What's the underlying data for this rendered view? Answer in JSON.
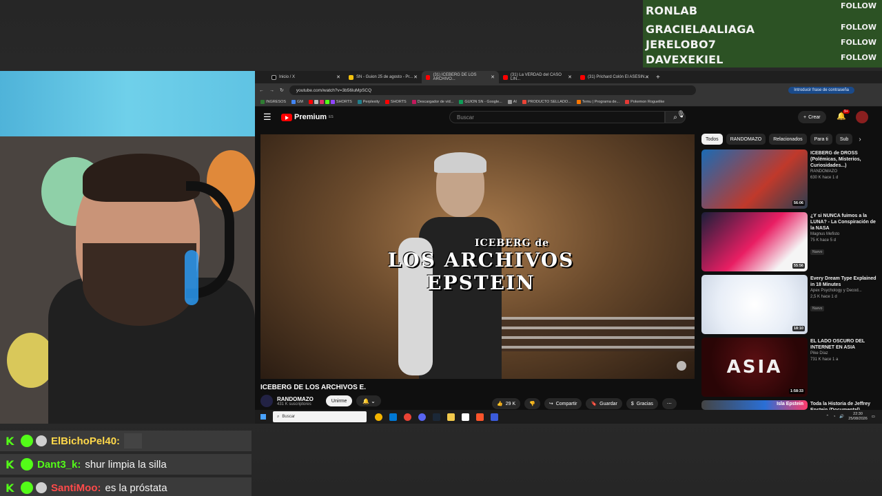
{
  "follows": [
    {
      "name": "RONLAB",
      "tag": "FOLLOW"
    },
    {
      "name": "GRACIELAALIAGA",
      "tag": "FOLLOW"
    },
    {
      "name": "JERELOBO7",
      "tag": "FOLLOW"
    },
    {
      "name": "DAVEXEKIEL",
      "tag": "FOLLOW"
    }
  ],
  "chat": [
    {
      "user": "ElBichoPel40:",
      "message": ""
    },
    {
      "user": "Dant3_k:",
      "message": "shur limpia la silla"
    },
    {
      "user": "SantiMoo:",
      "message": "es la próstata"
    }
  ],
  "browser": {
    "tabs": [
      "Inicio / X",
      "SN - Guion 25 de agosto - Pr...",
      "(31) ICEBERG DE LOS ARCHIVO...",
      "(31) La VERDAD del CASO LIN...",
      "(31) Prichard Colón El ASESIN..."
    ],
    "new_tab": "+",
    "url": "youtube.com/watch?v=3b56luMpSCQ",
    "password_prompt": "Introducir frase de contraseña",
    "bookmarks": [
      "INGRESOS",
      "GM",
      "SHORTS",
      "Perplexity",
      "SHORTS",
      "Descargador de víd...",
      "GUION SN - Google...",
      "AI",
      "PRODUCTO SELLADO...",
      "Temu | Programa de...",
      "Pokemon Roguelike"
    ]
  },
  "youtube": {
    "logo": "Premium",
    "region": "ES",
    "search_placeholder": "Buscar",
    "create_label": "Crear",
    "notif_count": "9+",
    "video_overlay_top": "ICEBERG de",
    "video_overlay_main": "LOS ARCHIVOS EPSTEIN",
    "video_title": "ICEBERG DE LOS ARCHIVOS E.",
    "channel_name": "RANDOMAZO",
    "channel_subs": "431 K suscriptores",
    "join_label": "Unirme",
    "likes": "29 K",
    "share_label": "Compartir",
    "save_label": "Guardar",
    "thanks_label": "Gracias",
    "chips": [
      "Todos",
      "RANDOMAZO",
      "Relacionados",
      "Para ti",
      "Sub"
    ],
    "recommendations": [
      {
        "title": "ICEBERG de DROSS (Polémicas, Misterios, Curiosidades...)",
        "channel": "RANDOMAZO",
        "meta": "630 K  hace 1 d",
        "duration": "56:06",
        "badge": ""
      },
      {
        "title": "¿Y si NUNCA fuimos a la LUNA? - La Conspiración de la NASA",
        "channel": "Magnus Mefisto",
        "meta": "75 K  hace 5 d",
        "duration": "55:56",
        "badge": "Nuevo"
      },
      {
        "title": "Every Dream Type Explained in 18 Minutes",
        "channel": "Apex Psychology y Decod...",
        "meta": "2,5 K  hace 1 d",
        "duration": "18:10",
        "badge": "Nuevo"
      },
      {
        "title": "EL LADO OSCURO DEL INTERNET EN ASIA",
        "channel": "Pike Díaz",
        "meta": "731 K  hace 1 a",
        "duration": "1:58:33",
        "badge": ""
      },
      {
        "title": "Toda la Historia de Jeffrey Epstein (Documental)",
        "channel": "",
        "meta": "",
        "duration": "",
        "badge": ""
      }
    ],
    "rec4_overlay": "ASIA",
    "rec5_overlay": "Isla Epstein"
  },
  "taskbar": {
    "search_placeholder": "Buscar",
    "time": "22:30",
    "date": "25/08/2026"
  },
  "colors": {
    "follow_bg": "#2c5224",
    "kick_green": "#53fc18",
    "yt_red": "#ff0000"
  }
}
